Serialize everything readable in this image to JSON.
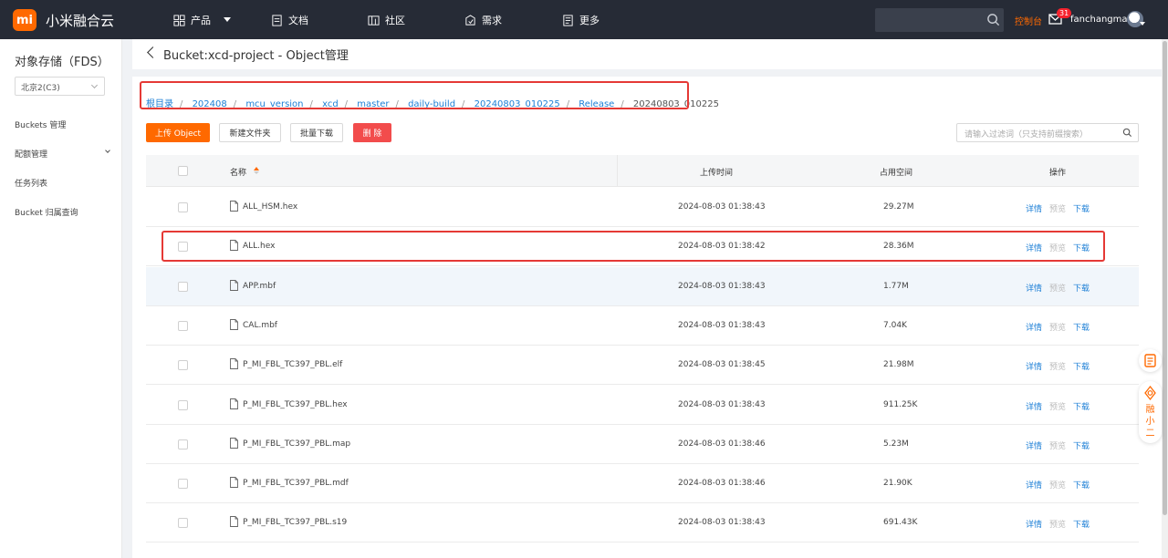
{
  "topbar": {
    "logo": "mi",
    "brand": "小米融合云",
    "nav": [
      {
        "label": "产品",
        "icon": "grid-icon"
      },
      {
        "label": "文档",
        "icon": "doc-icon"
      },
      {
        "label": "社区",
        "icon": "community-icon"
      },
      {
        "label": "需求",
        "icon": "request-icon"
      },
      {
        "label": "更多",
        "icon": "more-icon"
      }
    ],
    "console": "控制台",
    "notify_count": "31",
    "username": "fanchangmai"
  },
  "sidebar": {
    "title": "对象存储（FDS）",
    "region": "北京2(C3)",
    "items": [
      "Buckets 管理",
      "配额管理",
      "任务列表",
      "Bucket 归属查询"
    ]
  },
  "header": {
    "title": "Bucket:xcd-project - Object管理"
  },
  "breadcrumb": {
    "items": [
      "根目录",
      "202408",
      "mcu_version",
      "xcd",
      "master",
      "daily-build",
      "20240803_010225",
      "Release"
    ],
    "current": "20240803_010225",
    "separator": "/"
  },
  "toolbar": {
    "upload": "上传 Object",
    "new_folder": "新建文件夹",
    "batch_download": "批量下载",
    "delete": "删 除",
    "filter_placeholder": "请输入过滤词（只支持前缀搜索）"
  },
  "table": {
    "headers": {
      "name": "名称",
      "upload_time": "上传时间",
      "size": "占用空间",
      "ops": "操作"
    },
    "actions": {
      "detail": "详情",
      "preview": "预览",
      "download": "下载"
    },
    "rows": [
      {
        "name": "ALL_HSM.hex",
        "time": "2024-08-03 01:38:43",
        "size": "29.27M"
      },
      {
        "name": "ALL.hex",
        "time": "2024-08-03 01:38:42",
        "size": "28.36M"
      },
      {
        "name": "APP.mbf",
        "time": "2024-08-03 01:38:43",
        "size": "1.77M"
      },
      {
        "name": "CAL.mbf",
        "time": "2024-08-03 01:38:43",
        "size": "7.04K"
      },
      {
        "name": "P_MI_FBL_TC397_PBL.elf",
        "time": "2024-08-03 01:38:45",
        "size": "21.98M"
      },
      {
        "name": "P_MI_FBL_TC397_PBL.hex",
        "time": "2024-08-03 01:38:43",
        "size": "911.25K"
      },
      {
        "name": "P_MI_FBL_TC397_PBL.map",
        "time": "2024-08-03 01:38:46",
        "size": "5.23M"
      },
      {
        "name": "P_MI_FBL_TC397_PBL.mdf",
        "time": "2024-08-03 01:38:46",
        "size": "21.90K"
      },
      {
        "name": "P_MI_FBL_TC397_PBL.s19",
        "time": "2024-08-03 01:38:43",
        "size": "691.43K"
      }
    ]
  },
  "assistant": {
    "label": [
      "融",
      "小",
      "二"
    ]
  },
  "colors": {
    "brand": "#ff6900",
    "link": "#1c7fd6",
    "danger": "#f24c4c",
    "annotation": "#e53935"
  }
}
